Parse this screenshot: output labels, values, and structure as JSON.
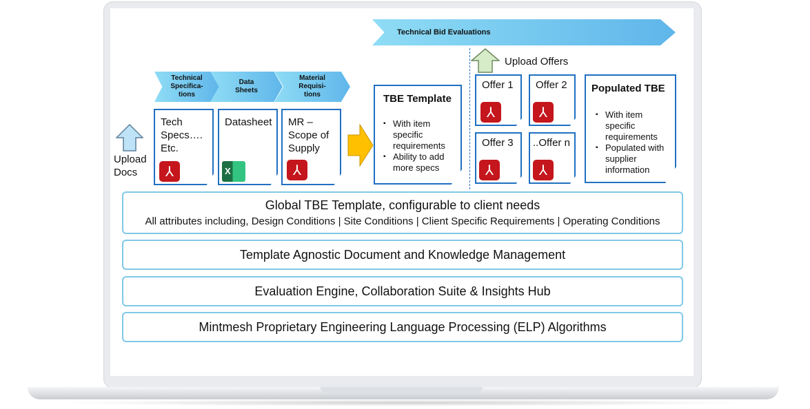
{
  "banner": {
    "title": "Technical Bid Evaluations"
  },
  "upload_docs": {
    "label_line1": "Upload",
    "label_line2": "Docs"
  },
  "upload_offers": {
    "label": "Upload Offers"
  },
  "stages": [
    {
      "label": "Technical Specifica-tions"
    },
    {
      "label": "Data Sheets"
    },
    {
      "label": "Material Requisi-tions"
    }
  ],
  "input_docs": [
    {
      "text": "Tech Specs…. Etc.",
      "icon": "pdf-icon"
    },
    {
      "text": "Datasheet",
      "icon": "excel-icon"
    },
    {
      "text": "MR – Scope of Supply",
      "icon": "pdf-icon"
    }
  ],
  "tbe_template": {
    "title": "TBE Template",
    "bullets": [
      "With item specific requirements",
      "Ability to add more specs"
    ]
  },
  "offers": [
    {
      "label": "Offer 1"
    },
    {
      "label": "Offer 2"
    },
    {
      "label": "Offer 3"
    },
    {
      "label": "..Offer n"
    }
  ],
  "populated_tbe": {
    "title": "Populated TBE",
    "bullets": [
      "With item specific requirements",
      "Populated with supplier information"
    ]
  },
  "layers": [
    {
      "title": "Global TBE Template, configurable to client needs",
      "subtitle": "All attributes including, Design Conditions | Site Conditions | Client Specific Requirements | Operating Conditions"
    },
    {
      "title": "Template Agnostic Document and Knowledge Management"
    },
    {
      "title": "Evaluation Engine, Collaboration Suite & Insights Hub"
    },
    {
      "title": "Mintmesh Proprietary Engineering Language Processing (ELP) Algorithms"
    }
  ],
  "colors": {
    "doc_border": "#1f6fc2",
    "pdf": "#c4161c",
    "excel": "#1d7044",
    "arrow_yellow": "#ffc000",
    "layer_border": "#7fc8e8"
  }
}
